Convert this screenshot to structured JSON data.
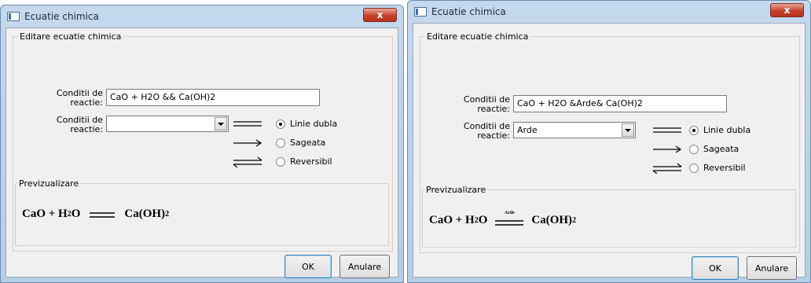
{
  "dialogs": [
    {
      "title": "Ecuatie chimica",
      "close_label": "x",
      "group_title": "Editare ecuatie chimica",
      "conditions_label": "Conditii de reactie:",
      "equation_value": "CaO + H2O && Ca(OH)2",
      "conditions_combo_label": "Conditii de reactie:",
      "conditions_combo_value": "",
      "radios": [
        {
          "label": "Linie dubla",
          "checked": true
        },
        {
          "label": "Sageata",
          "checked": false
        },
        {
          "label": "Reversibil",
          "checked": false
        }
      ],
      "preview_title": "Previzualizare",
      "preview": {
        "left_a": "CaO + H",
        "left_sub": "2",
        "left_b": "O",
        "right_a": "Ca(OH)",
        "right_sub": "2",
        "condition": ""
      },
      "ok_label": "OK",
      "cancel_label": "Anulare"
    },
    {
      "title": "Ecuatie chimica",
      "close_label": "x",
      "group_title": "Editare ecuatie chimica",
      "conditions_label": "Conditii de reactie:",
      "equation_value": "CaO + H2O &Arde& Ca(OH)2",
      "conditions_combo_label": "Conditii de reactie:",
      "conditions_combo_value": "Arde",
      "radios": [
        {
          "label": "Linie dubla",
          "checked": true
        },
        {
          "label": "Sageata",
          "checked": false
        },
        {
          "label": "Reversibil",
          "checked": false
        }
      ],
      "preview_title": "Previzualizare",
      "preview": {
        "left_a": "CaO + H",
        "left_sub": "2",
        "left_b": "O",
        "right_a": "Ca(OH)",
        "right_sub": "2",
        "condition": "Arde"
      },
      "ok_label": "OK",
      "cancel_label": "Anulare"
    }
  ],
  "colors": {
    "titlebar": "#c4d8ee",
    "close_button": "#c6422c",
    "client": "#f0f0f0"
  },
  "icons": [
    "window-icon",
    "close-icon",
    "dropdown-arrow-icon",
    "double-line-icon",
    "arrow-icon",
    "reversible-icon"
  ]
}
